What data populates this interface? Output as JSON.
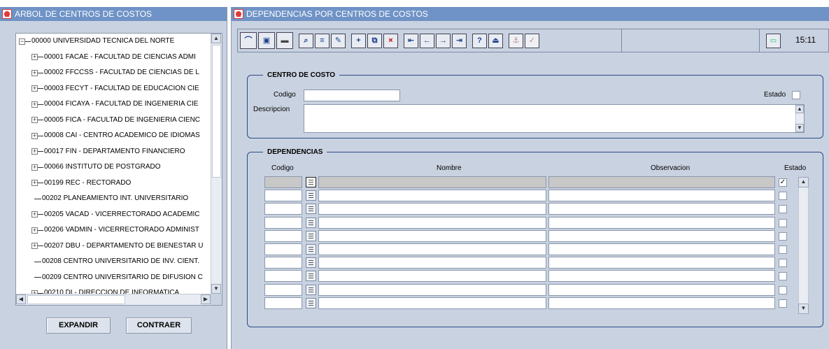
{
  "left_window": {
    "title": "ARBOL DE CENTROS DE COSTOS",
    "tree": {
      "root": "00000 UNIVERSIDAD TECNICA DEL NORTE",
      "items": [
        {
          "label": "00001 FACAE - FACULTAD DE CIENCIAS ADMI",
          "expandable": true
        },
        {
          "label": "00002 FFCCSS - FACULTAD DE CIENCIAS DE L",
          "expandable": true
        },
        {
          "label": "00003 FECYT - FACULTAD DE EDUCACION CIE",
          "expandable": true
        },
        {
          "label": "00004 FICAYA - FACULTAD DE INGENIERIA CIE",
          "expandable": true
        },
        {
          "label": "00005 FICA - FACULTAD DE INGENIERIA CIENC",
          "expandable": true
        },
        {
          "label": "00008 CAI - CENTRO ACADEMICO DE IDIOMAS",
          "expandable": true
        },
        {
          "label": "00017 FIN - DEPARTAMENTO FINANCIERO",
          "expandable": true
        },
        {
          "label": "00066 INSTITUTO DE POSTGRADO",
          "expandable": true
        },
        {
          "label": "00199 REC - RECTORADO",
          "expandable": true
        },
        {
          "label": "00202 PLANEAMIENTO INT. UNIVERSITARIO",
          "expandable": false
        },
        {
          "label": "00205 VACAD - VICERRECTORADO ACADEMIC",
          "expandable": true
        },
        {
          "label": "00206 VADMIN - VICERRECTORADO ADMINIST",
          "expandable": true
        },
        {
          "label": "00207 DBU - DEPARTAMENTO DE BIENESTAR U",
          "expandable": true
        },
        {
          "label": "00208 CENTRO UNIVERSITARIO DE INV. CIENT.",
          "expandable": false
        },
        {
          "label": "00209 CENTRO UNIVERSITARIO DE DIFUSION C",
          "expandable": false
        },
        {
          "label": "00210 DI - DIRECCION DE INFORMATICA",
          "expandable": true
        }
      ]
    },
    "buttons": {
      "expand": "EXPANDIR",
      "collapse": "CONTRAER"
    }
  },
  "right_window": {
    "title": "DEPENDENCIAS POR CENTROS DE COSTOS",
    "toolbar": {
      "icons": [
        "broom-icon",
        "save-icon",
        "print-icon",
        "search-icon",
        "list-icon",
        "edit-icon",
        "insert-record-icon",
        "duplicate-record-icon",
        "delete-record-icon",
        "first-record-icon",
        "previous-record-icon",
        "next-record-icon",
        "last-record-icon",
        "help-icon",
        "exit-icon",
        "anchor-icon",
        "check-icon"
      ],
      "time": "15:11"
    },
    "centro": {
      "legend": "CENTRO DE COSTO",
      "codigo_label": "Codigo",
      "codigo_value": "",
      "descripcion_label": "Descripcion",
      "descripcion_value": "",
      "estado_label": "Estado",
      "estado_checked": false
    },
    "dependencias": {
      "legend": "DEPENDENCIAS",
      "headers": {
        "codigo": "Codigo",
        "nombre": "Nombre",
        "observacion": "Observacion",
        "estado": "Estado"
      },
      "rows": [
        {
          "codigo": "",
          "nombre": "",
          "observacion": "",
          "estado": true
        },
        {
          "codigo": "",
          "nombre": "",
          "observacion": "",
          "estado": false
        },
        {
          "codigo": "",
          "nombre": "",
          "observacion": "",
          "estado": false
        },
        {
          "codigo": "",
          "nombre": "",
          "observacion": "",
          "estado": false
        },
        {
          "codigo": "",
          "nombre": "",
          "observacion": "",
          "estado": false
        },
        {
          "codigo": "",
          "nombre": "",
          "observacion": "",
          "estado": false
        },
        {
          "codigo": "",
          "nombre": "",
          "observacion": "",
          "estado": false
        },
        {
          "codigo": "",
          "nombre": "",
          "observacion": "",
          "estado": false
        },
        {
          "codigo": "",
          "nombre": "",
          "observacion": "",
          "estado": false
        },
        {
          "codigo": "",
          "nombre": "",
          "observacion": "",
          "estado": false
        }
      ]
    }
  },
  "colors": {
    "titlebar": "#6f93c6",
    "window_bg": "#c9d2e0",
    "frame": "#2a4b88"
  }
}
